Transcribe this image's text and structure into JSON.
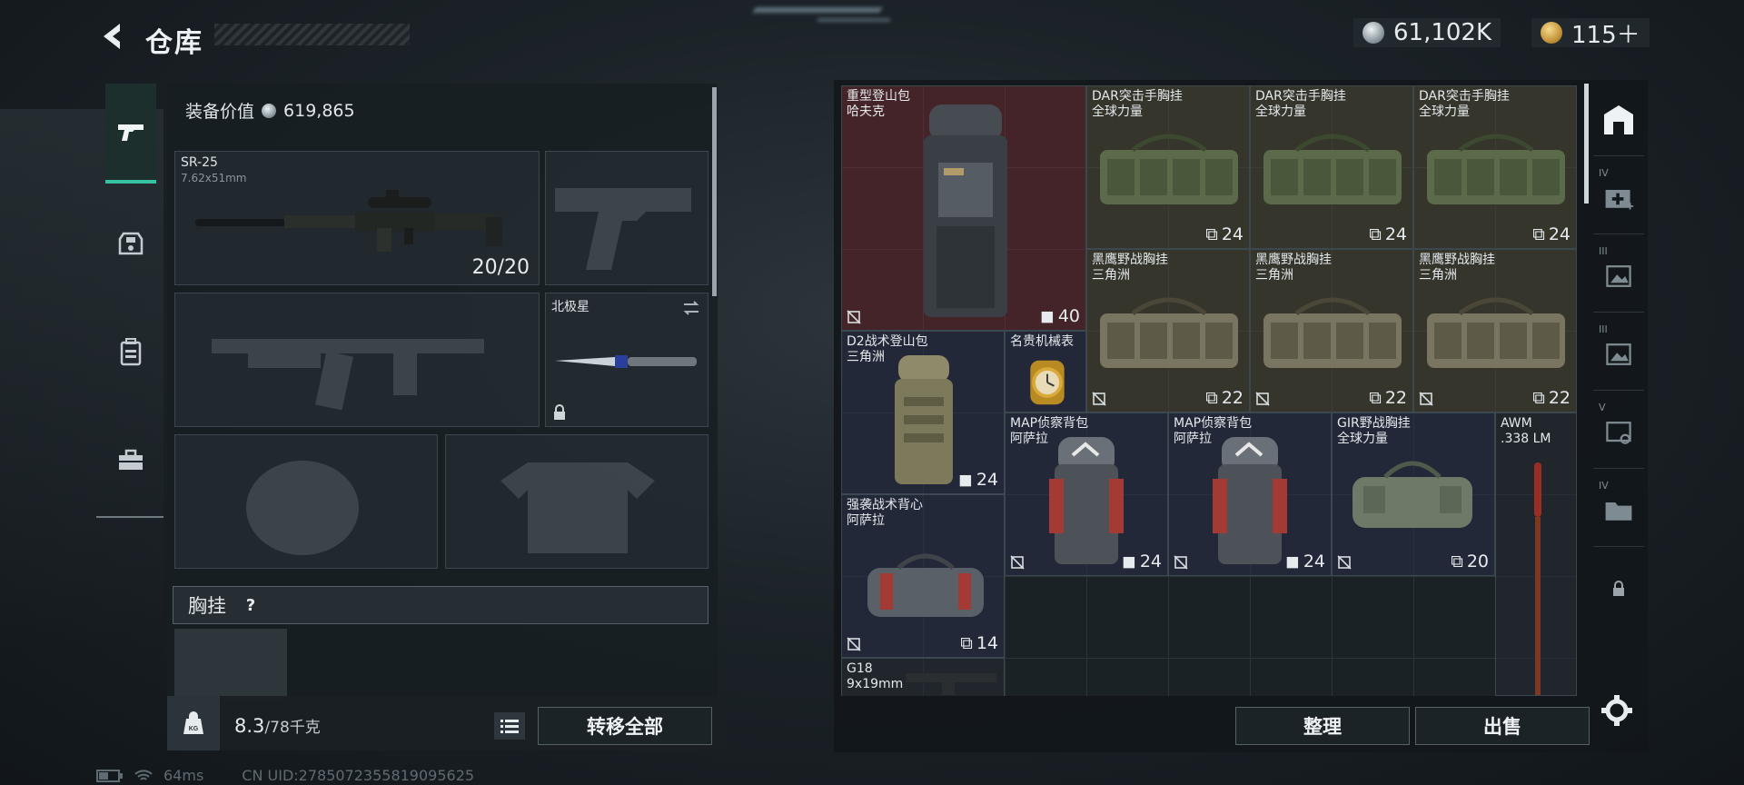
{
  "header": {
    "title": "仓库",
    "currencies": [
      {
        "icon": "silver-coin-icon",
        "value": "61,102K"
      },
      {
        "icon": "gold-coin-icon",
        "value": "115＋"
      }
    ]
  },
  "categories": [
    {
      "icon": "pistol-icon",
      "active": true
    },
    {
      "icon": "helmet-armor-icon",
      "active": false
    },
    {
      "icon": "backpack-icon",
      "active": false
    },
    {
      "icon": "toolbox-icon",
      "active": false
    }
  ],
  "equipment": {
    "value_label": "装备价值",
    "value": "619,865",
    "primary_weapon": {
      "name": "SR-25",
      "caliber": "7.62x51mm",
      "ammo": "20/20"
    },
    "melee": {
      "name": "北极星"
    },
    "chest_rig_label": "胸挂",
    "help_symbol": "?",
    "weight": {
      "current": "8.3",
      "max": "/78千克"
    },
    "weight_icon_text": "KG",
    "transfer_all": "转移全部"
  },
  "stash": {
    "items": [
      {
        "id": "heavy-pack",
        "name": "重型登山包",
        "brand": "哈夫克",
        "cap": "40",
        "cap_icon": "backpack-capacity-icon",
        "color": "red"
      },
      {
        "id": "dar-1",
        "name": "DAR突击手胸挂",
        "brand": "全球力量",
        "cap": "24",
        "cap_icon": "vest-capacity-icon",
        "color": "olive"
      },
      {
        "id": "dar-2",
        "name": "DAR突击手胸挂",
        "brand": "全球力量",
        "cap": "24",
        "cap_icon": "vest-capacity-icon",
        "color": "olive"
      },
      {
        "id": "dar-3",
        "name": "DAR突击手胸挂",
        "brand": "全球力量",
        "cap": "24",
        "cap_icon": "vest-capacity-icon",
        "color": "olive"
      },
      {
        "id": "heiying-1",
        "name": "黑鹰野战胸挂",
        "brand": "三角洲",
        "cap": "22",
        "cap_icon": "vest-capacity-icon",
        "color": "olive"
      },
      {
        "id": "heiying-2",
        "name": "黑鹰野战胸挂",
        "brand": "三角洲",
        "cap": "22",
        "cap_icon": "vest-capacity-icon",
        "color": "olive"
      },
      {
        "id": "heiying-3",
        "name": "黑鹰野战胸挂",
        "brand": "三角洲",
        "cap": "22",
        "cap_icon": "vest-capacity-icon",
        "color": "olive"
      },
      {
        "id": "d2-pack",
        "name": "D2战术登山包",
        "brand": "三角洲",
        "cap": "24",
        "cap_icon": "backpack-capacity-icon",
        "color": "blue"
      },
      {
        "id": "watch",
        "name": "名贵机械表",
        "brand": "",
        "cap": "",
        "color": "blue"
      },
      {
        "id": "map-1",
        "name": "MAP侦察背包",
        "brand": "阿萨拉",
        "cap": "24",
        "cap_icon": "backpack-capacity-icon",
        "color": "blue"
      },
      {
        "id": "map-2",
        "name": "MAP侦察背包",
        "brand": "阿萨拉",
        "cap": "24",
        "cap_icon": "backpack-capacity-icon",
        "color": "blue"
      },
      {
        "id": "gir-rig",
        "name": "GIR野战胸挂",
        "brand": "全球力量",
        "cap": "20",
        "cap_icon": "vest-capacity-icon",
        "color": "blue"
      },
      {
        "id": "awm-ammo",
        "name": "AWM",
        "brand": ".338 LM",
        "cap": "",
        "color": "grey"
      },
      {
        "id": "assault-vest",
        "name": "强袭战术背心",
        "brand": "阿萨拉",
        "cap": "14",
        "cap_icon": "vest-capacity-icon",
        "color": "blue"
      },
      {
        "id": "g18",
        "name": "G18",
        "brand": "9x19mm",
        "cap": "",
        "color": "grey"
      }
    ],
    "side_tabs": [
      {
        "icon": "home-stash-icon",
        "level": ""
      },
      {
        "icon": "medical-case-icon",
        "level": "IV"
      },
      {
        "icon": "image-case-icon",
        "level": "III"
      },
      {
        "icon": "image-case-icon",
        "level": "III"
      },
      {
        "icon": "key-case-icon",
        "level": "V"
      },
      {
        "icon": "folder-case-icon",
        "level": "IV"
      },
      {
        "icon": "lock-icon",
        "level": ""
      }
    ],
    "sort_label": "整理",
    "sell_label": "出售"
  },
  "status_bar": {
    "ping": "64ms",
    "uid": "CN UID:2785072355819095625"
  },
  "colors": {
    "accent": "#36c2a0",
    "red_item": "#78282c",
    "olive_item": "#4a4630",
    "blue_item": "#282e46"
  }
}
